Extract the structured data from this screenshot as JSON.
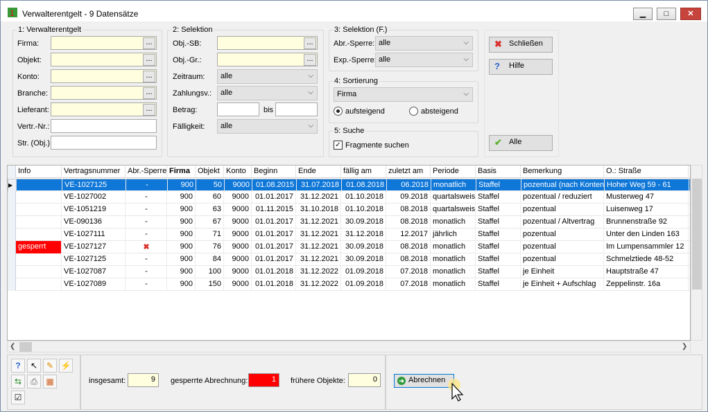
{
  "window": {
    "title": "Verwalterentgelt - 9 Datensätze",
    "min": "▁",
    "max": "□",
    "close": "✕"
  },
  "g1": {
    "legend": "1: Verwalterentgelt",
    "firma": "Firma:",
    "objekt": "Objekt:",
    "konto": "Konto:",
    "branche": "Branche:",
    "lieferant": "Lieferant:",
    "vertr_nr": "Vertr.-Nr.:",
    "str_obj": "Str. (Obj.):",
    "dots": "..."
  },
  "g2": {
    "legend": "2: Selektion",
    "obj_sb": "Obj.-SB:",
    "obj_gr": "Obj.-Gr.:",
    "zeitraum": "Zeitraum:",
    "zeitraum_val": "alle",
    "zahlungsv": "Zahlungsv.:",
    "zahlungsv_val": "alle",
    "betrag": "Betrag:",
    "bis": "bis",
    "faelligkeit": "Fälligkeit:",
    "faelligkeit_val": "alle"
  },
  "g3": {
    "legend": "3: Selektion (F.)",
    "abr": "Abr.-Sperre:",
    "abr_val": "alle",
    "exp": "Exp.-Sperre:",
    "exp_val": "alle"
  },
  "g4": {
    "legend": "4: Sortierung",
    "field": "Firma",
    "asc": "aufsteigend",
    "desc": "absteigend"
  },
  "g5": {
    "legend": "5: Suche",
    "frag": "Fragmente suchen"
  },
  "actions": {
    "close": "Schließen",
    "help": "Hilfe",
    "all": "Alle"
  },
  "columns": [
    "Info",
    "Vertragsnummer",
    "Abr.-Sperre",
    "Firma",
    "Objekt",
    "Konto",
    "Beginn",
    "Ende",
    "fällig am",
    "zuletzt am",
    "Periode",
    "Basis",
    "Bemerkung",
    "O.: Straße"
  ],
  "rows": [
    {
      "info": "",
      "nr": "VE-1027125",
      "sperre": "-",
      "firma": "900",
      "objekt": "50",
      "konto": "9000",
      "beginn": "01.08.2015",
      "ende": "31.07.2018",
      "faellig": "01.08.2018",
      "zuletzt": "06.2018",
      "periode": "monatlich",
      "basis": "Staffel",
      "bem": "pozentual (nach Konten)",
      "str": "Hoher Weg 59 - 61"
    },
    {
      "info": "",
      "nr": "VE-1027002",
      "sperre": "-",
      "firma": "900",
      "objekt": "60",
      "konto": "9000",
      "beginn": "01.01.2017",
      "ende": "31.12.2021",
      "faellig": "01.10.2018",
      "zuletzt": "09.2018",
      "periode": "quartalsweise",
      "basis": "Staffel",
      "bem": "pozentual / reduziert",
      "str": "Musterweg 47"
    },
    {
      "info": "",
      "nr": "VE-1051219",
      "sperre": "-",
      "firma": "900",
      "objekt": "63",
      "konto": "9000",
      "beginn": "01.11.2015",
      "ende": "31.10.2018",
      "faellig": "01.10.2018",
      "zuletzt": "08.2018",
      "periode": "quartalsweise",
      "basis": "Staffel",
      "bem": "pozentual",
      "str": "Luisenweg 17"
    },
    {
      "info": "",
      "nr": "VE-090136",
      "sperre": "-",
      "firma": "900",
      "objekt": "67",
      "konto": "9000",
      "beginn": "01.01.2017",
      "ende": "31.12.2021",
      "faellig": "30.09.2018",
      "zuletzt": "08.2018",
      "periode": "monatlich",
      "basis": "Staffel",
      "bem": "pozentual / Altvertrag",
      "str": "Brunnenstraße 92"
    },
    {
      "info": "",
      "nr": "VE-1027111",
      "sperre": "-",
      "firma": "900",
      "objekt": "71",
      "konto": "9000",
      "beginn": "01.01.2017",
      "ende": "31.12.2021",
      "faellig": "31.12.2018",
      "zuletzt": "12.2017",
      "periode": "jährlich",
      "basis": "Staffel",
      "bem": "pozentual",
      "str": "Unter den Linden 163"
    },
    {
      "info": "gesperrt",
      "nr": "VE-1027127",
      "sperre": "✖",
      "firma": "900",
      "objekt": "76",
      "konto": "9000",
      "beginn": "01.01.2017",
      "ende": "31.12.2021",
      "faellig": "30.09.2018",
      "zuletzt": "08.2018",
      "periode": "monatlich",
      "basis": "Staffel",
      "bem": "pozentual",
      "str": "Im Lumpensammler 12"
    },
    {
      "info": "",
      "nr": "VE-1027125",
      "sperre": "-",
      "firma": "900",
      "objekt": "84",
      "konto": "9000",
      "beginn": "01.01.2017",
      "ende": "31.12.2021",
      "faellig": "30.09.2018",
      "zuletzt": "08.2018",
      "periode": "monatlich",
      "basis": "Staffel",
      "bem": "pozentual",
      "str": "Schmelztiede 48-52"
    },
    {
      "info": "",
      "nr": "VE-1027087",
      "sperre": "-",
      "firma": "900",
      "objekt": "100",
      "konto": "9000",
      "beginn": "01.01.2018",
      "ende": "31.12.2022",
      "faellig": "01.09.2018",
      "zuletzt": "07.2018",
      "periode": "monatlich",
      "basis": "Staffel",
      "bem": "je Einheit",
      "str": "Hauptstraße 47"
    },
    {
      "info": "",
      "nr": "VE-1027089",
      "sperre": "-",
      "firma": "900",
      "objekt": "150",
      "konto": "9000",
      "beginn": "01.01.2018",
      "ende": "31.12.2022",
      "faellig": "01.09.2018",
      "zuletzt": "07.2018",
      "periode": "monatlich",
      "basis": "Staffel",
      "bem": "je Einheit + Aufschlag",
      "str": "Zeppelinstr. 16a"
    }
  ],
  "status": {
    "insgesamt": "insgesamt:",
    "insgesamt_val": "9",
    "gesperrt": "gesperrte Abrechnung:",
    "gesperrt_val": "1",
    "frueher": "frühere Objekte:",
    "frueher_val": "0",
    "abrechnen": "Abrechnen"
  },
  "colors": {
    "selection": "#0f77d8",
    "locked": "#ff0000",
    "input_yellow": "#ffffe0"
  }
}
